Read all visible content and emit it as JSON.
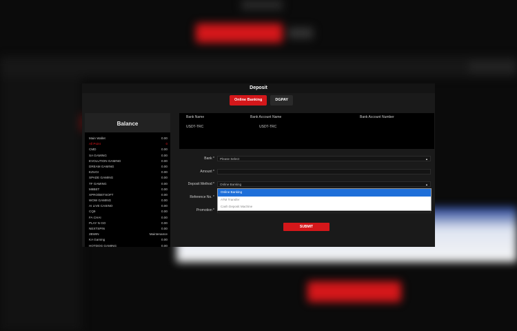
{
  "modal": {
    "title": "Deposit",
    "tabs": [
      {
        "label": "Online Banking",
        "active": true
      },
      {
        "label": "DGPAY",
        "active": false
      }
    ]
  },
  "balance": {
    "title": "Balance",
    "rows": [
      {
        "name": "Main Wallet",
        "value": "0.00"
      },
      {
        "name": "All Point",
        "value": "0",
        "highlight": true
      },
      {
        "name": "CMD",
        "value": "0.00"
      },
      {
        "name": "SA GAMING",
        "value": "0.00"
      },
      {
        "name": "EVOLUTION GAMING",
        "value": "0.00"
      },
      {
        "name": "DREAM GAMING",
        "value": "0.00"
      },
      {
        "name": "EZUGI",
        "value": "0.00"
      },
      {
        "name": "SPADE GAMING",
        "value": "0.00"
      },
      {
        "name": "TF GAMING",
        "value": "0.00"
      },
      {
        "name": "M8BET",
        "value": "0.00"
      },
      {
        "name": "XPRO/BETSOFT",
        "value": "0.00"
      },
      {
        "name": "WOW GAMING",
        "value": "0.00"
      },
      {
        "name": "AI LIVE CASINO",
        "value": "0.00"
      },
      {
        "name": "CQ9",
        "value": "0.00"
      },
      {
        "name": "FA CHAI",
        "value": "0.00"
      },
      {
        "name": "PLAY N GO",
        "value": "0.00"
      },
      {
        "name": "NEXTSPIN",
        "value": "0.00"
      },
      {
        "name": "2BWIN",
        "value": "Maintenance"
      },
      {
        "name": "KA Gaming",
        "value": "0.00"
      },
      {
        "name": "HOTDOG GAMING",
        "value": "0.00"
      }
    ]
  },
  "bank_table": {
    "headers": [
      "Bank Name",
      "Bank Account Name",
      "Bank Account Number"
    ],
    "row": [
      "USDT-TRC",
      "USDT-TRC",
      ""
    ]
  },
  "form": {
    "bank": {
      "label": "Bank *",
      "value": "Please Select"
    },
    "amount": {
      "label": "Amount *",
      "value": ""
    },
    "deposit_method": {
      "label": "Deposit Method *",
      "value": "Online Banking"
    },
    "reference": {
      "label": "Reference No. *",
      "value": ""
    },
    "promotion": {
      "label": "Promotion *",
      "value": ""
    },
    "dropdown_options": [
      {
        "label": "Online Banking",
        "selected": true
      },
      {
        "label": "ATM Transfer",
        "selected": false
      },
      {
        "label": "Cash Deposit Machine",
        "selected": false
      }
    ],
    "submit_label": "SUBMIT"
  },
  "colors": {
    "accent": "#d4171a",
    "select_highlight": "#1e6fd9"
  }
}
